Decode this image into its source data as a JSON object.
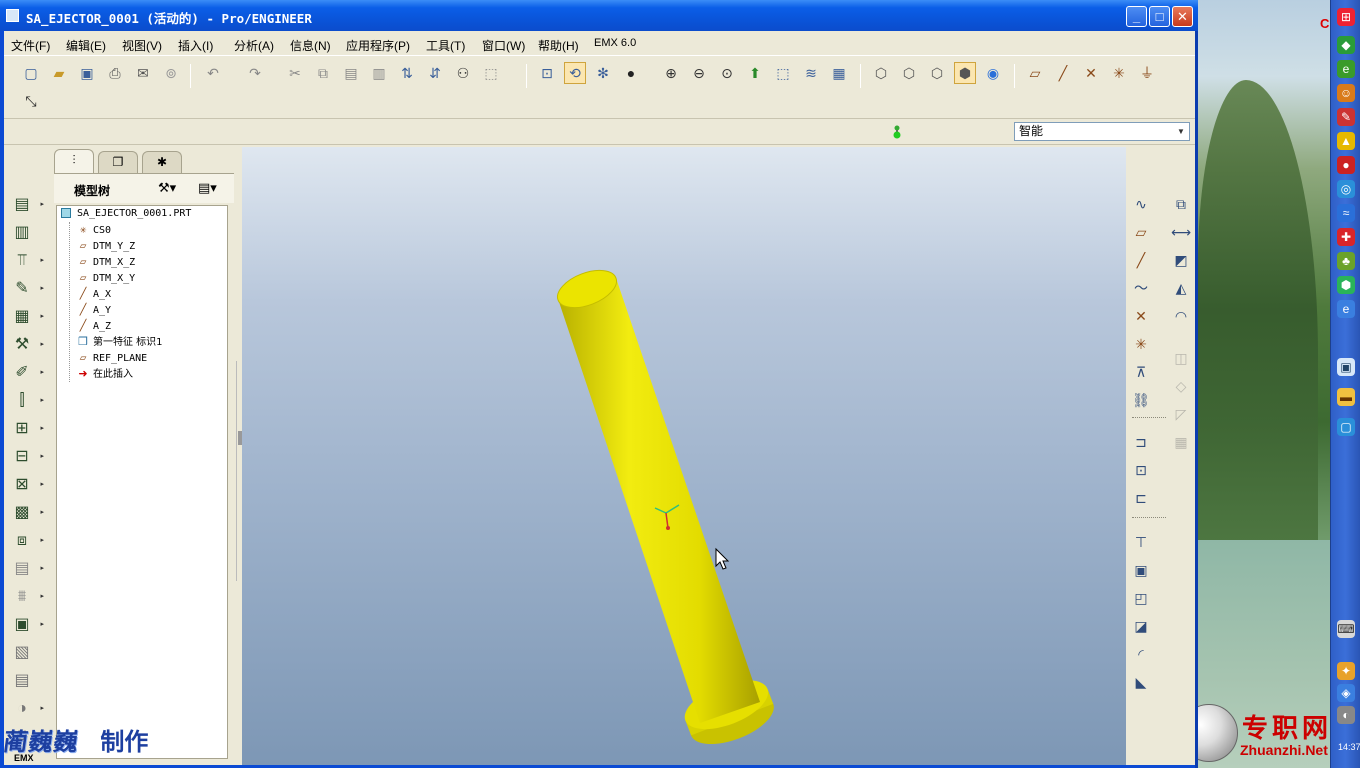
{
  "window": {
    "title": "SA_EJECTOR_0001 (活动的) - Pro/ENGINEER",
    "controls": {
      "minimize": "_",
      "maximize": "□",
      "close": "✕"
    }
  },
  "menu": [
    {
      "label": "文件(F)"
    },
    {
      "label": "编辑(E)"
    },
    {
      "label": "视图(V)"
    },
    {
      "label": "插入(I)"
    },
    {
      "label": "分析(A)"
    },
    {
      "label": "信息(N)"
    },
    {
      "label": "应用程序(P)"
    },
    {
      "label": "工具(T)"
    },
    {
      "label": "窗口(W)"
    },
    {
      "label": "帮助(H)"
    },
    {
      "label": "EMX 6.0"
    }
  ],
  "toolbar": {
    "filter_select": "智能"
  },
  "model_tree": {
    "header_title": "模型树",
    "items": [
      {
        "label": "SA_EJECTOR_0001.PRT",
        "icon": "part-icon"
      },
      {
        "label": "CS0",
        "icon": "coordinate-system-icon"
      },
      {
        "label": "DTM_Y_Z",
        "icon": "datum-plane-icon"
      },
      {
        "label": "DTM_X_Z",
        "icon": "datum-plane-icon"
      },
      {
        "label": "DTM_X_Y",
        "icon": "datum-plane-icon"
      },
      {
        "label": "A_X",
        "icon": "datum-axis-icon"
      },
      {
        "label": "A_Y",
        "icon": "datum-axis-icon"
      },
      {
        "label": "A_Z",
        "icon": "datum-axis-icon"
      },
      {
        "label": "第一特征 标识1",
        "icon": "feature-icon"
      },
      {
        "label": "REF_PLANE",
        "icon": "datum-plane-icon"
      },
      {
        "label": "在此插入",
        "icon": "insert-here-arrow-icon"
      }
    ]
  },
  "left_toolbar_extra_label": "EMX",
  "overlay": {
    "credit_brand": "蔺巍巍",
    "credit_make": "制作",
    "watermark_cn": "专职网",
    "watermark_en": "Zhuanzhi.Net",
    "clock": "14:37",
    "corner_letter": "C"
  },
  "colors": {
    "titlebar": "#0b5ee8",
    "part_yellow": "#e5e000",
    "viewport_top": "#dfe7f0",
    "viewport_bottom": "#7d97b5"
  }
}
